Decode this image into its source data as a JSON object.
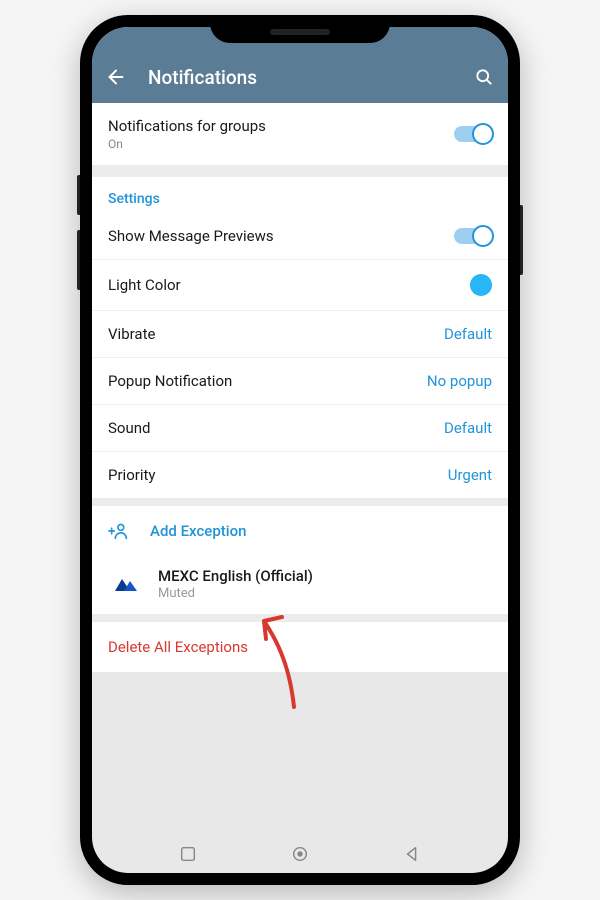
{
  "header": {
    "title": "Notifications"
  },
  "groups_section": {
    "title": "Notifications for groups",
    "sub": "On"
  },
  "settings_header": "Settings",
  "settings": [
    {
      "label": "Show Message Previews",
      "kind": "toggle"
    },
    {
      "label": "Light Color",
      "kind": "color"
    },
    {
      "label": "Vibrate",
      "value": "Default"
    },
    {
      "label": "Popup Notification",
      "value": "No popup"
    },
    {
      "label": "Sound",
      "value": "Default"
    },
    {
      "label": "Priority",
      "value": "Urgent"
    }
  ],
  "add_exception": "Add Exception",
  "exceptions": [
    {
      "name": "MEXC English (Official)",
      "status": "Muted"
    }
  ],
  "delete_all": "Delete All Exceptions"
}
